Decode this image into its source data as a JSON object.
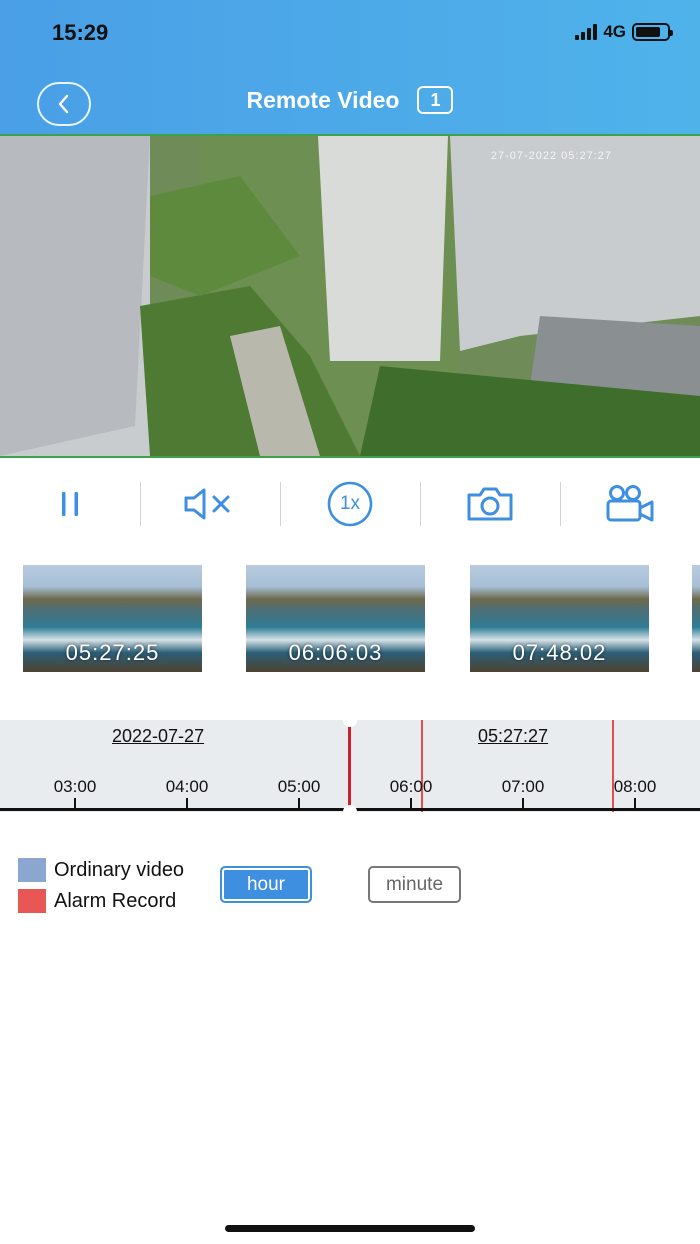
{
  "status_bar": {
    "time": "15:29",
    "network": "4G"
  },
  "header": {
    "title": "Remote Video",
    "channel": "1"
  },
  "video": {
    "timestamp": "27-07-2022 05:27:27"
  },
  "controls": {
    "pause": "pause-icon",
    "mute": "speaker-muted-icon",
    "speed": "1x",
    "snapshot": "camera-icon",
    "record": "video-camera-icon"
  },
  "thumbnails": [
    {
      "time": "05:27:25"
    },
    {
      "time": "06:06:03"
    },
    {
      "time": "07:48:02"
    }
  ],
  "timeline": {
    "date": "2022-07-27",
    "current_time": "05:27:27",
    "hours": [
      "03:00",
      "04:00",
      "05:00",
      "06:00",
      "07:00",
      "08:00"
    ]
  },
  "legend": {
    "ordinary": {
      "label": "Ordinary video",
      "color": "#8aa6d1"
    },
    "alarm": {
      "label": "Alarm Record",
      "color": "#e85656"
    }
  },
  "units": {
    "hour": "hour",
    "minute": "minute",
    "selected": "hour"
  },
  "colors": {
    "accent": "#4a9fe6",
    "alarm_line": "#e84b4b"
  }
}
